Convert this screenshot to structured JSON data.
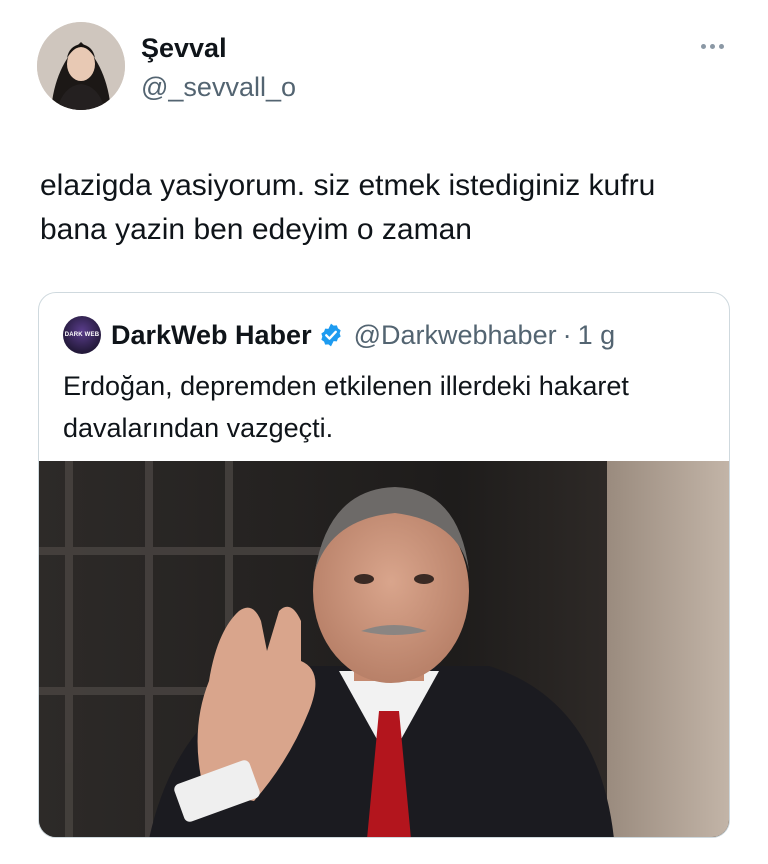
{
  "author": {
    "display_name": "Şevval",
    "handle": "@_sevvall_o"
  },
  "tweet": {
    "text_line1": "elazigda yasiyorum. siz etmek istediginiz kufru",
    "text_line2": "bana yazin ben edeyim o zaman"
  },
  "quoted_tweet": {
    "avatar_text": "DARK WEB",
    "display_name": "DarkWeb Haber",
    "handle": "@Darkwebhaber",
    "separator": "·",
    "time": "1 g",
    "text_line1": "Erdoğan, depremden etkilenen illerdeki hakaret",
    "text_line2": "davalarından vazgeçti."
  },
  "icons": {
    "more": "more-horizontal-icon",
    "verified": "verified-badge-icon"
  },
  "colors": {
    "text_primary": "#0f1419",
    "text_secondary": "#536471",
    "verified_blue": "#1d9bf0",
    "border": "#cfd9de"
  }
}
